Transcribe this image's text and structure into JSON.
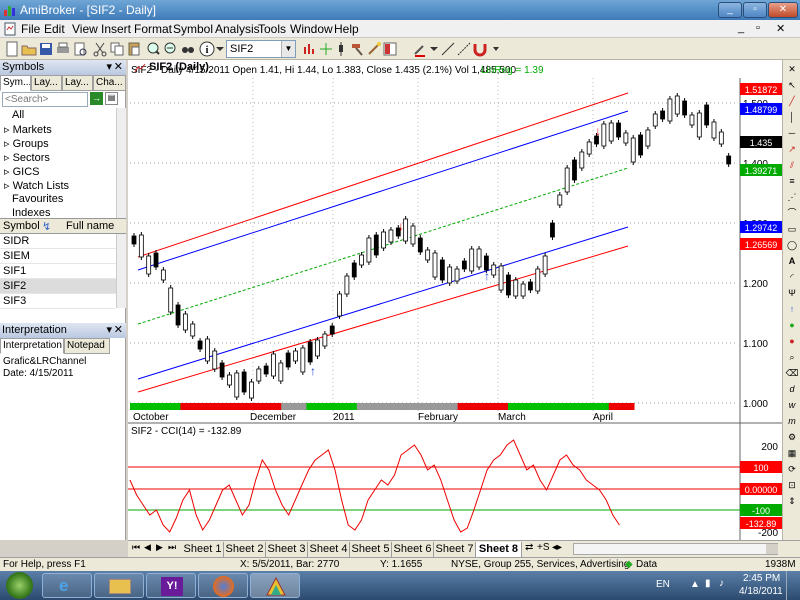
{
  "window": {
    "title": "AmiBroker - [SIF2 - Daily]"
  },
  "menu": [
    "File",
    "Edit",
    "View",
    "Insert",
    "Format",
    "Symbol",
    "Analysis",
    "Tools",
    "Window",
    "Help"
  ],
  "toolbar": {
    "symbol_combo": "SIF2"
  },
  "symbols_panel": {
    "title": "Symbols",
    "tabs": [
      "Sym...",
      "Lay...",
      "Lay...",
      "Cha..."
    ],
    "search_placeholder": "<Search>",
    "tree": [
      "All",
      "Markets",
      "Groups",
      "Sectors",
      "GICS",
      "Watch Lists",
      "Favourites",
      "Indexes"
    ],
    "list_headers": [
      "Symbol",
      "Full name"
    ],
    "list": [
      "SIDR",
      "SIEM",
      "SIF1",
      "SIF2",
      "SIF3"
    ]
  },
  "interpretation_panel": {
    "title": "Interpretation",
    "tabs": [
      "Interpretation",
      "Notepad"
    ],
    "lines": [
      "Grafic&LRChannel",
      "Date: 4/15/2011"
    ]
  },
  "chart": {
    "tab_label": "SIF2 (Daily)",
    "price_header": "SIF2 - Daily 4/15/2011 Open 1.41, Hi 1.44, Lo 1.383, Close 1.435 (2.1%) Vol 1,485,500",
    "linreg_label": "LinReg = 1.39",
    "price_axis": [
      "1.500",
      "1.400",
      "1.300",
      "1.200",
      "1.100",
      "1.000"
    ],
    "price_badges": [
      {
        "text": "1.51872",
        "color": "#ff0000"
      },
      {
        "text": "1.48799",
        "color": "#0000ff"
      },
      {
        "text": "1.435",
        "color": "#000000"
      },
      {
        "text": "1.39271",
        "color": "#00aa00"
      },
      {
        "text": "1.29742",
        "color": "#0000ff"
      },
      {
        "text": "1.26569",
        "color": "#ff0000"
      }
    ],
    "months": [
      "October",
      "December",
      "2011",
      "February",
      "March",
      "April"
    ],
    "cci_header": "SIF2 - CCI(14) = -132.89",
    "cci_axis": [
      "200",
      "100",
      "0.00000",
      "-100",
      "-200"
    ],
    "cci_badges": [
      {
        "text": "100",
        "color": "#ff0000"
      },
      {
        "text": "0.00000",
        "color": "#ff0000"
      },
      {
        "text": "-100",
        "color": "#00aa00"
      },
      {
        "text": "-132.89",
        "color": "#ff0000"
      }
    ],
    "colors": {
      "up": "#ffffff",
      "down": "#000000",
      "channel_outer": "#ff0000",
      "channel_inner": "#0000ff",
      "linreg": "#00aa00"
    }
  },
  "sheets": [
    "Sheet 1",
    "Sheet 2",
    "Sheet 3",
    "Sheet 4",
    "Sheet 5",
    "Sheet 6",
    "Sheet 7",
    "Sheet 8"
  ],
  "status": {
    "help": "For Help, press F1",
    "coords": "X: 5/5/2011, Bar: 2770",
    "yval": "Y: 1.1655",
    "info": "NYSE, Group 255, Services, Advertising",
    "data": "Data",
    "mem": "1938M"
  },
  "taskbar": {
    "lang": "EN",
    "time": "2:45 PM",
    "date": "4/18/2011"
  }
}
